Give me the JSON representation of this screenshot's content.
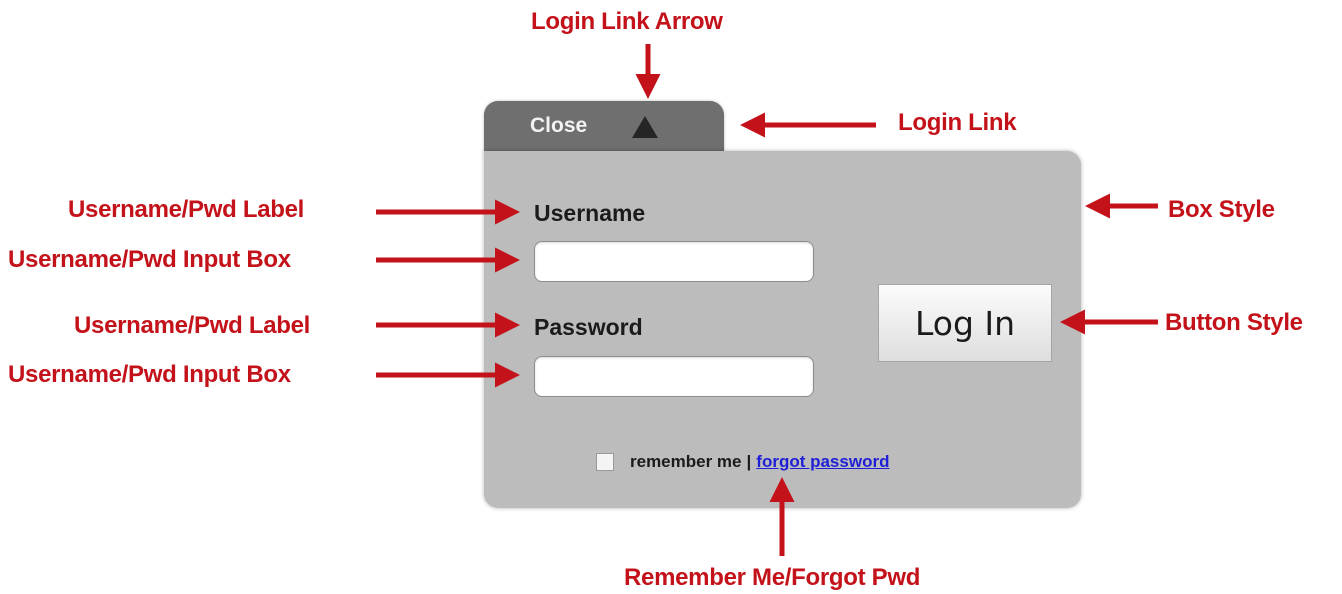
{
  "widget": {
    "tab": {
      "label": "Close",
      "arrow_icon": "triangle-up-icon"
    },
    "username_label": "Username",
    "password_label": "Password",
    "login_button": "Log In",
    "remember_label": "remember me",
    "separator": "|",
    "forgot_link": "forgot password",
    "username_value": "",
    "password_value": ""
  },
  "annotations": {
    "login_link_arrow": "Login Link Arrow",
    "login_link": "Login Link",
    "username_label": "Username/Pwd Label",
    "username_input": "Username/Pwd Input Box",
    "password_label": "Username/Pwd Label",
    "password_input": "Username/Pwd Input Box",
    "box_style": "Box Style",
    "button_style": "Button Style",
    "remember_forgot": "Remember Me/Forgot Pwd"
  },
  "colors": {
    "annotation": "#c4121a",
    "tab": "#6f6f6f",
    "box": "#bcbcbc",
    "link": "#1f1fd8"
  }
}
